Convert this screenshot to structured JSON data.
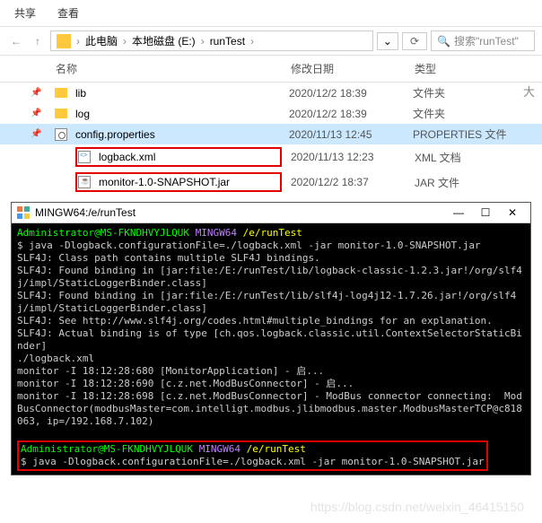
{
  "toolbar": {
    "share": "共享",
    "view": "查看"
  },
  "breadcrumb": {
    "this_pc": "此电脑",
    "drive": "本地磁盘 (E:)",
    "folder": "runTest"
  },
  "search": {
    "placeholder": "搜索\"runTest\""
  },
  "columns": {
    "name": "名称",
    "date": "修改日期",
    "type": "类型",
    "big": "大"
  },
  "files": [
    {
      "name": "lib",
      "date": "2020/12/2 18:39",
      "type": "文件夹",
      "icon": "folder",
      "pinned": true
    },
    {
      "name": "log",
      "date": "2020/12/2 18:39",
      "type": "文件夹",
      "icon": "folder",
      "pinned": true
    },
    {
      "name": "config.properties",
      "date": "2020/11/13 12:45",
      "type": "PROPERTIES 文件",
      "icon": "cfg",
      "pinned": true,
      "selected": true
    },
    {
      "name": "logback.xml",
      "date": "2020/11/13 12:23",
      "type": "XML 文档",
      "icon": "xml",
      "redbox": true
    },
    {
      "name": "monitor-1.0-SNAPSHOT.jar",
      "date": "2020/12/2 18:37",
      "type": "JAR 文件",
      "icon": "jar",
      "redbox": true
    }
  ],
  "terminal": {
    "title": "MINGW64:/e/runTest",
    "prompt_user": "Administrator@MS-FKNDHVYJLQUK",
    "prompt_env": "MINGW64",
    "prompt_path": "/e/runTest",
    "cmd1": "$ java -Dlogback.configurationFile=./logback.xml -jar monitor-1.0-SNAPSHOT.jar",
    "out": [
      "SLF4J: Class path contains multiple SLF4J bindings.",
      "SLF4J: Found binding in [jar:file:/E:/runTest/lib/logback-classic-1.2.3.jar!/org/slf4j/impl/StaticLoggerBinder.class]",
      "SLF4J: Found binding in [jar:file:/E:/runTest/lib/slf4j-log4j12-1.7.26.jar!/org/slf4j/impl/StaticLoggerBinder.class]",
      "SLF4J: See http://www.slf4j.org/codes.html#multiple_bindings for an explanation.",
      "SLF4J: Actual binding is of type [ch.qos.logback.classic.util.ContextSelectorStaticBinder]",
      "./logback.xml",
      "monitor -I 18:12:28:680 [MonitorApplication] - 启...",
      "monitor -I 18:12:28:690 [c.z.net.ModBusConnector] - 启...",
      "monitor -I 18:12:28:698 [c.z.net.ModBusConnector] - ModBus connector connecting:  ModBusConnector(modbusMaster=com.intelligt.modbus.jlibmodbus.master.ModbusMasterTCP@c818063, ip=/192.168.7.102)"
    ],
    "cmd2": "$ java -Dlogback.configurationFile=./logback.xml -jar monitor-1.0-SNAPSHOT.jar"
  },
  "watermark": "https://blog.csdn.net/weixin_46415150"
}
